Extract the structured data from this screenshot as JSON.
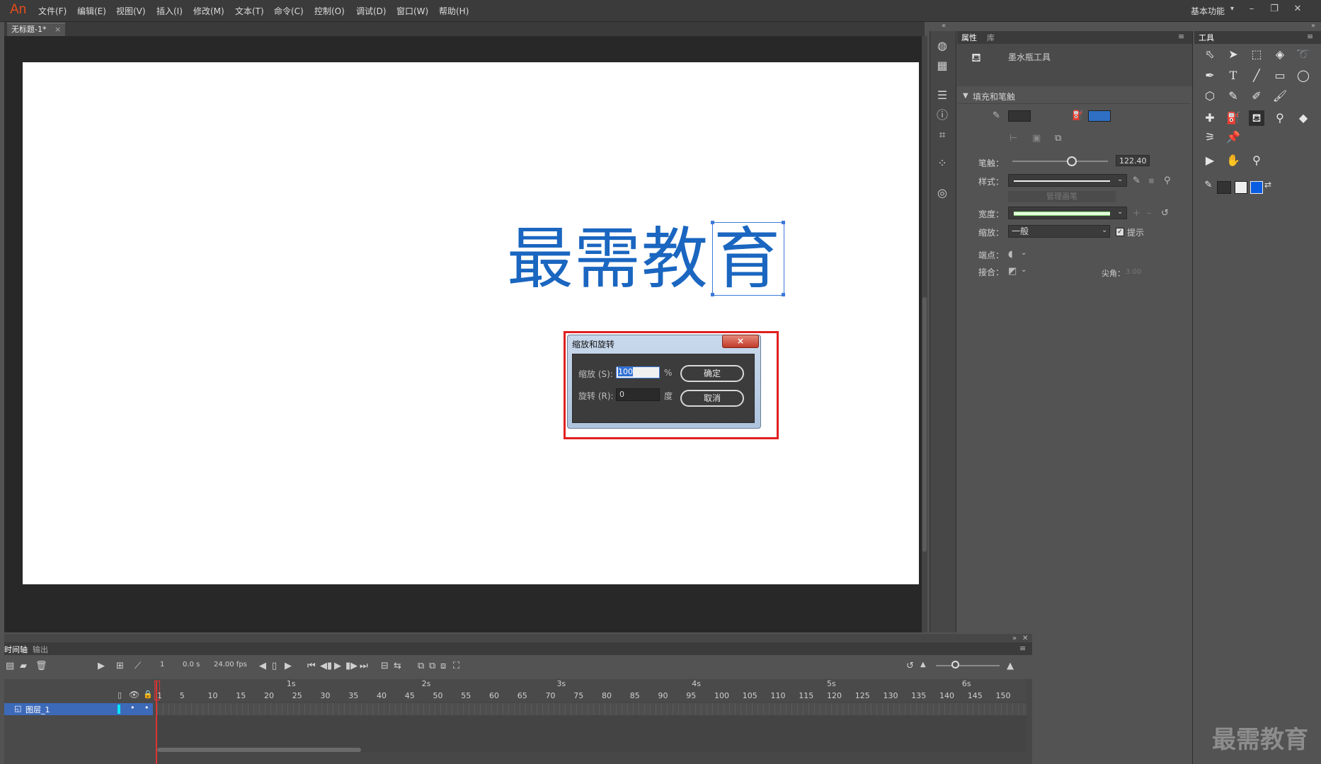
{
  "app": {
    "logo": "An",
    "workspace": "基本功能"
  },
  "menu": [
    "文件(F)",
    "编辑(E)",
    "视图(V)",
    "插入(I)",
    "修改(M)",
    "文本(T)",
    "命令(C)",
    "控制(O)",
    "调试(D)",
    "窗口(W)",
    "帮助(H)"
  ],
  "document": {
    "tab_label": "无标题-1*",
    "close_glyph": "×"
  },
  "stage": {
    "chars": [
      "最",
      "需",
      "教",
      "育"
    ],
    "text_color": "#1a66c0"
  },
  "dialog": {
    "title": "缩放和旋转",
    "close_glyph": "×",
    "scale_label": "缩放 (S):",
    "scale_value": "100",
    "scale_unit": "%",
    "rotate_label": "旋转 (R):",
    "rotate_value": "0",
    "rotate_unit": "度",
    "ok_label": "确定",
    "cancel_label": "取消"
  },
  "properties": {
    "tabs": [
      "属性",
      "库"
    ],
    "tool_name": "墨水瓶工具",
    "section_fill_stroke": "填充和笔触",
    "stroke_color": "#333333",
    "fill_color": "#2f6fc4",
    "stroke_label": "笔触：",
    "stroke_value": "122.40",
    "style_label": "样式：",
    "manage_brush": "管理画笔",
    "width_label": "宽度：",
    "scale_label": "缩放：",
    "scale_value": "一般",
    "hint_label": "提示",
    "cap_label": "端点：",
    "join_label": "接合：",
    "miter_label": "尖角：",
    "miter_value": "3.00"
  },
  "tools": {
    "tab_label": "工具"
  },
  "timeline": {
    "tabs": [
      "时间轴",
      "输出"
    ],
    "frame_number": "1",
    "time": "0.0 s",
    "fps": "24.00 fps",
    "layer_name": "图层_1",
    "seconds": [
      "1s",
      "2s",
      "3s",
      "4s",
      "5s",
      "6s"
    ],
    "ticks": [
      "1",
      "5",
      "10",
      "15",
      "20",
      "25",
      "30",
      "35",
      "40",
      "45",
      "50",
      "55",
      "60",
      "65",
      "70",
      "75",
      "80",
      "85",
      "90",
      "95",
      "100",
      "105",
      "110",
      "115",
      "120",
      "125",
      "130",
      "135",
      "140",
      "145",
      "150"
    ]
  },
  "watermark": "最需教育"
}
